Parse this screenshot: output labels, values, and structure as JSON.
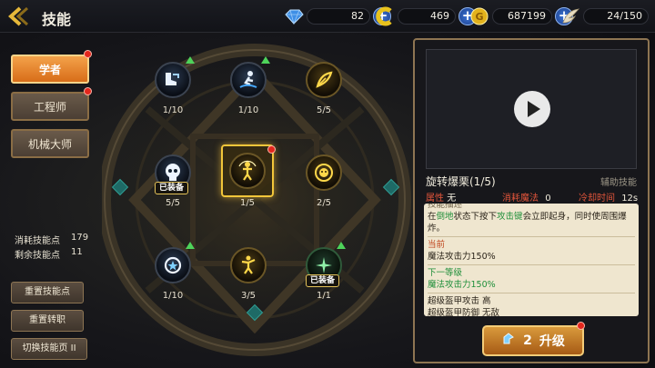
{
  "header": {
    "back_icon": "back-arrow-icon",
    "title": "技能"
  },
  "resources": [
    {
      "name": "diamond",
      "icon": "blue-crystal-icon",
      "value": "82",
      "color": "#3e8fe6"
    },
    {
      "name": "energy",
      "icon": "yellow-c-icon",
      "value": "469",
      "color": "#e8c21d"
    },
    {
      "name": "gold",
      "icon": "gold-coin-icon",
      "value": "687199",
      "color": "#e2b21c"
    },
    {
      "name": "stamina",
      "icon": "wing-icon",
      "value": "24/150",
      "color": "#e8dcc0"
    }
  ],
  "classes": [
    {
      "label": "学者",
      "active": true,
      "red_dot": true
    },
    {
      "label": "工程师",
      "active": false,
      "red_dot": true
    },
    {
      "label": "机械大师",
      "active": false,
      "red_dot": false
    }
  ],
  "stats": [
    {
      "label": "消耗技能点",
      "value": "179"
    },
    {
      "label": "剩余技能点",
      "value": "11"
    }
  ],
  "left_buttons": [
    "重置技能点",
    "重置转职",
    "切换技能页 II"
  ],
  "skills": [
    {
      "id": "s1",
      "level": "1/10",
      "icon": "boots-icon",
      "style": "blue",
      "upgrade": true
    },
    {
      "id": "s2",
      "level": "1/10",
      "icon": "dash-runner-icon",
      "style": "blue",
      "upgrade": true
    },
    {
      "id": "s3",
      "level": "5/5",
      "icon": "scroll-leaf-icon",
      "style": "gold",
      "upgrade": false
    },
    {
      "id": "s4",
      "level": "5/5",
      "icon": "skull-icon",
      "style": "blue",
      "upgrade": false,
      "badge": "已装备"
    },
    {
      "id": "s5",
      "level": "1/5",
      "icon": "spin-explosion-icon",
      "style": "gold",
      "upgrade": false,
      "selected": true,
      "red_dot": true
    },
    {
      "id": "s6",
      "level": "2/5",
      "icon": "mask-face-icon",
      "style": "gold",
      "upgrade": false
    },
    {
      "id": "s7",
      "level": "1/10",
      "icon": "star-burst-icon",
      "style": "blue",
      "upgrade": true
    },
    {
      "id": "s8",
      "level": "3/5",
      "icon": "jumping-figure-icon",
      "style": "gold",
      "upgrade": false
    },
    {
      "id": "s9",
      "level": "1/1",
      "icon": "sparkle-icon",
      "style": "blue",
      "upgrade": true,
      "badge": "已装备"
    }
  ],
  "detail": {
    "name": "旋转爆栗(1/5)",
    "type": "辅助技能",
    "attr_label": "属性",
    "attr_value": "无",
    "mana_label": "消耗魔法",
    "mana_value": "0",
    "cd_label": "冷却时间",
    "cd_value": "12s",
    "desc_header": "技能描述",
    "desc_parts": [
      {
        "text": "在",
        "color": "#2b241a"
      },
      {
        "text": "倒地",
        "color": "#1f8f3a"
      },
      {
        "text": "状态下按下",
        "color": "#2b241a"
      },
      {
        "text": "攻击键",
        "color": "#1f8f3a"
      },
      {
        "text": "会立即起身，同时使周围爆炸。",
        "color": "#2b241a"
      }
    ],
    "current_label": "当前",
    "current_value": "魔法攻击力150%",
    "next_label": "下一等级",
    "next_value": "魔法攻击力150%",
    "extra_line1": "超级盔甲攻击 高",
    "extra_line2": "超级盔甲防御 无敌"
  },
  "upgrade": {
    "cost": "2",
    "label": "升级",
    "icon": "skill-point-icon"
  }
}
